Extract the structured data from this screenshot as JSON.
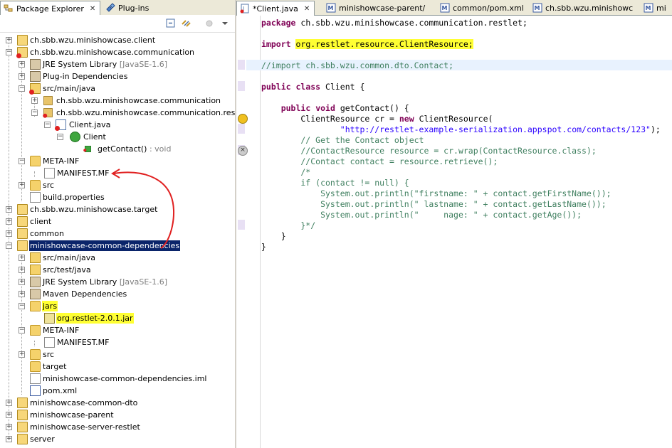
{
  "explorer": {
    "tabs": [
      {
        "label": "Package Explorer",
        "close": "✕"
      },
      {
        "label": "Plug-ins"
      }
    ],
    "tree": [
      {
        "label": "ch.sbb.wzu.minishowcase.client"
      },
      {
        "label": "ch.sbb.wzu.minishowcase.communication"
      },
      {
        "label": "JRE System Library",
        "decoration": "[JavaSE-1.6]"
      },
      {
        "label": "Plug-in Dependencies"
      },
      {
        "label": "src/main/java"
      },
      {
        "label": "ch.sbb.wzu.minishowcase.communication"
      },
      {
        "label": "ch.sbb.wzu.minishowcase.communication.restlet"
      },
      {
        "label": "Client.java"
      },
      {
        "label": "Client"
      },
      {
        "label": "getContact()",
        "decoration": ": void"
      },
      {
        "label": "META-INF"
      },
      {
        "label": "MANIFEST.MF"
      },
      {
        "label": "src"
      },
      {
        "label": "build.properties"
      },
      {
        "label": "ch.sbb.wzu.minishowcase.target"
      },
      {
        "label": "client"
      },
      {
        "label": "common"
      },
      {
        "label": "minishowcase-common-dependencies"
      },
      {
        "label": "src/main/java"
      },
      {
        "label": "src/test/java"
      },
      {
        "label": "JRE System Library",
        "decoration": "[JavaSE-1.6]"
      },
      {
        "label": "Maven Dependencies"
      },
      {
        "label": "jars"
      },
      {
        "label": "org.restlet-2.0.1.jar"
      },
      {
        "label": "META-INF"
      },
      {
        "label": "MANIFEST.MF"
      },
      {
        "label": "src"
      },
      {
        "label": "target"
      },
      {
        "label": "minishowcase-common-dependencies.iml"
      },
      {
        "label": "pom.xml"
      },
      {
        "label": "minishowcase-common-dto"
      },
      {
        "label": "minishowcase-parent"
      },
      {
        "label": "minishowcase-server-restlet"
      },
      {
        "label": "server"
      }
    ]
  },
  "editor": {
    "tabs": [
      {
        "label": "*Client.java",
        "close": "✕"
      },
      {
        "label": "minishowcase-parent/"
      },
      {
        "label": "common/pom.xml"
      },
      {
        "label": "ch.sbb.wzu.minishowc"
      },
      {
        "label": "mi"
      }
    ],
    "code": {
      "l1_kw": "package",
      "l1_rest": " ch.sbb.wzu.minishowcase.communication.restlet;",
      "l3_kw": "import",
      "l3_rest": "org.restlet.resource.ClientResource;",
      "l5": "//import ch.sbb.wzu.common.dto.Contact;",
      "l7_kw1": "public",
      "l7_kw2": "class",
      "l7_rest": " Client {",
      "l9_kw1": "public",
      "l9_kw2": "void",
      "l9_rest": " getContact() {",
      "l10_a": "        ClientResource cr = ",
      "l10_kw": "new",
      "l10_b": " ClientResource(",
      "l11_str": "\"http://restlet-example-serialization.appspot.com/contacts/123\"",
      "l11_end": ");",
      "l12": "        // Get the Contact object",
      "l13": "        //ContactResource resource = cr.wrap(ContactResource.class);",
      "l14": "        //Contact contact = resource.retrieve();",
      "l15": "        /*",
      "l16": "        if (contact != null) {",
      "l17": "            System.out.println(\"firstname: \" + contact.getFirstName());",
      "l18": "            System.out.println(\" lastname: \" + contact.getLastName());",
      "l19": "            System.out.println(\"     nage: \" + contact.getAge());",
      "l20": "        }*/",
      "l21": "    }",
      "l22": "}"
    }
  },
  "colors": {
    "keyword": "#7f0055",
    "string": "#2a00ff",
    "comment": "#3f7f5f",
    "highlight": "#ffff33",
    "selection": "#0a246a",
    "annotation": "#e02020"
  }
}
